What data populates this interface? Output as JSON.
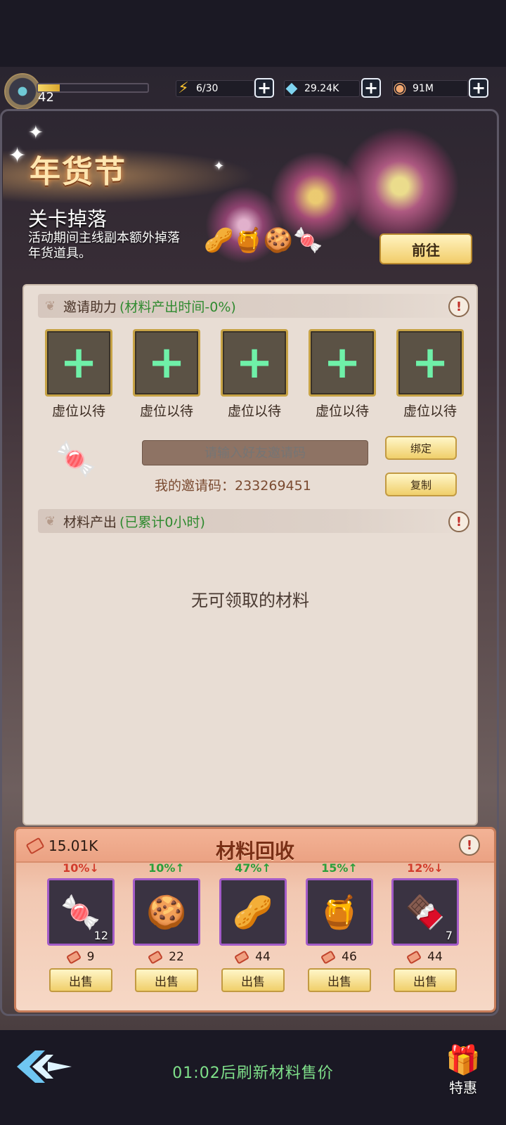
{
  "player": {
    "level": "42",
    "exp_fraction": 0.2
  },
  "resources": {
    "energy": {
      "value": "6/30",
      "icon": "lightning-icon"
    },
    "diamonds": {
      "value": "29.24K",
      "icon": "diamond-icon"
    },
    "coins": {
      "value": "91M",
      "icon": "coin-icon"
    }
  },
  "banner": {
    "title": "年货节",
    "subtitle": "关卡掉落",
    "description": "活动期间主线副本额外掉落年货道具。",
    "go_label": "前往"
  },
  "invite": {
    "section_title": "邀请助力",
    "section_note": "(材料产出时间-0%)",
    "slots": [
      "虚位以待",
      "虚位以待",
      "虚位以待",
      "虚位以待",
      "虚位以待"
    ],
    "input_placeholder": "请输入好友邀请码",
    "bind_label": "绑定",
    "copy_label": "复制",
    "my_code_label": "我的邀请码：233269451"
  },
  "output": {
    "section_title": "材料产出",
    "section_note": "(已累计0小时)",
    "empty_message": "无可领取的材料"
  },
  "recycle": {
    "title": "材料回收",
    "ticket_total": "15.01K",
    "sell_label": "出售",
    "items": [
      {
        "name": "candy",
        "change": "10%↓",
        "trend": "down",
        "qty": "12",
        "price": "9"
      },
      {
        "name": "macaron",
        "change": "10%↑",
        "trend": "up",
        "qty": "",
        "price": "22"
      },
      {
        "name": "almond",
        "change": "47%↑",
        "trend": "up",
        "qty": "",
        "price": "44"
      },
      {
        "name": "honeycomb",
        "change": "15%↑",
        "trend": "up",
        "qty": "",
        "price": "46"
      },
      {
        "name": "chocolate",
        "change": "12%↓",
        "trend": "down",
        "qty": "7",
        "price": "44"
      }
    ]
  },
  "footer": {
    "refresh_text": "01:02后刷新材料售价",
    "special_label": "特惠"
  },
  "colors": {
    "accent_green": "#6ff0a8",
    "trend_up": "#2aa03a",
    "trend_down": "#d23c2c",
    "button_gold": "#f0cf6a"
  }
}
